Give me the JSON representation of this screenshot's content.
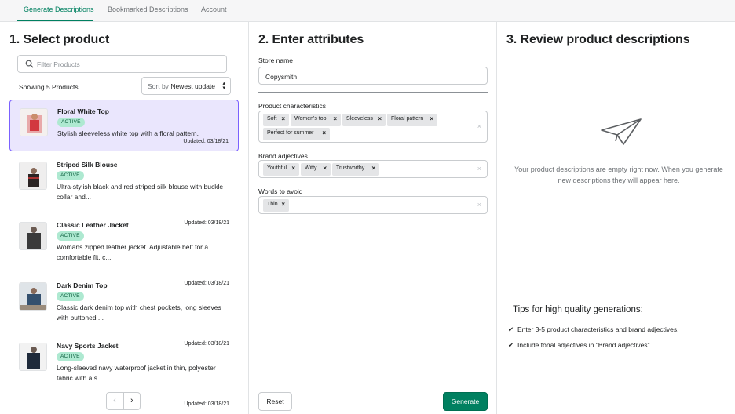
{
  "nav": {
    "tabs": [
      "Generate Descriptions",
      "Bookmarked Descriptions",
      "Account"
    ]
  },
  "select": {
    "title": "1. Select product",
    "search_placeholder": "Filter Products",
    "showing": "Showing 5 Products",
    "sort_prefix": "Sort by",
    "sort_value": "Newest update",
    "products": [
      {
        "name": "Floral White Top",
        "status": "ACTIVE",
        "desc": "Stylish sleeveless white top with a floral pattern.",
        "updated": "Updated: 03/18/21"
      },
      {
        "name": "Striped Silk Blouse",
        "status": "ACTIVE",
        "desc": "Ultra-stylish black and red striped silk blouse with buckle collar and...",
        "updated": "Updated: 03/18/21"
      },
      {
        "name": "Classic Leather Jacket",
        "status": "ACTIVE",
        "desc": "Womans zipped leather jacket. Adjustable belt for a comfortable fit, c...",
        "updated": "Updated: 03/18/21"
      },
      {
        "name": "Dark Denim Top",
        "status": "ACTIVE",
        "desc": "Classic dark denim top with chest pockets, long sleeves with buttoned ...",
        "updated": "Updated: 03/18/21"
      },
      {
        "name": "Navy Sports Jacket",
        "status": "ACTIVE",
        "desc": "Long-sleeved navy waterproof jacket in thin, polyester fabric with a s...",
        "updated": "Updated: 03/18/21"
      }
    ]
  },
  "attributes": {
    "title": "2. Enter attributes",
    "store_label": "Store name",
    "store_value": "Copysmith",
    "characteristics_label": "Product characteristics",
    "characteristics": [
      "Soft",
      "Women's top",
      "Sleeveless",
      "Floral pattern",
      "Perfect for summer"
    ],
    "adjectives_label": "Brand adjectives",
    "adjectives": [
      "Youthful",
      "Witty",
      "Trustworthy"
    ],
    "avoid_label": "Words to avoid",
    "avoid": [
      "Thin"
    ],
    "reset_label": "Reset",
    "generate_label": "Generate"
  },
  "review": {
    "title": "3. Review product descriptions",
    "empty_message": "Your product descriptions are empty right now. When you generate new descriptions they will appear here.",
    "tips_title": "Tips for high quality generations:",
    "tips": [
      "Enter 3-5 product characteristics and brand adjectives.",
      "Include tonal adjectives in \"Brand adjectives\""
    ]
  },
  "colors": {
    "accent": "#008060",
    "selected_bg": "#eae6fd",
    "selected_border": "#7b61ff",
    "badge_bg": "#aee9d1"
  }
}
